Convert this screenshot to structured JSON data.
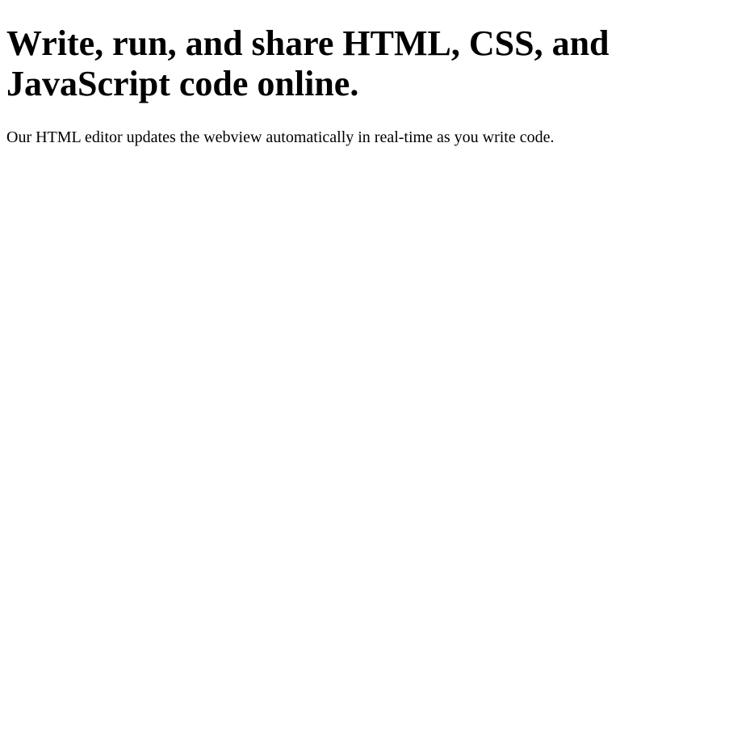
{
  "main": {
    "heading": "Write, run, and share HTML, CSS, and JavaScript code online.",
    "description": "Our HTML editor updates the webview automatically in real-time as you write code."
  },
  "colors": {
    "background": "#ffffff",
    "text": "#000000"
  }
}
